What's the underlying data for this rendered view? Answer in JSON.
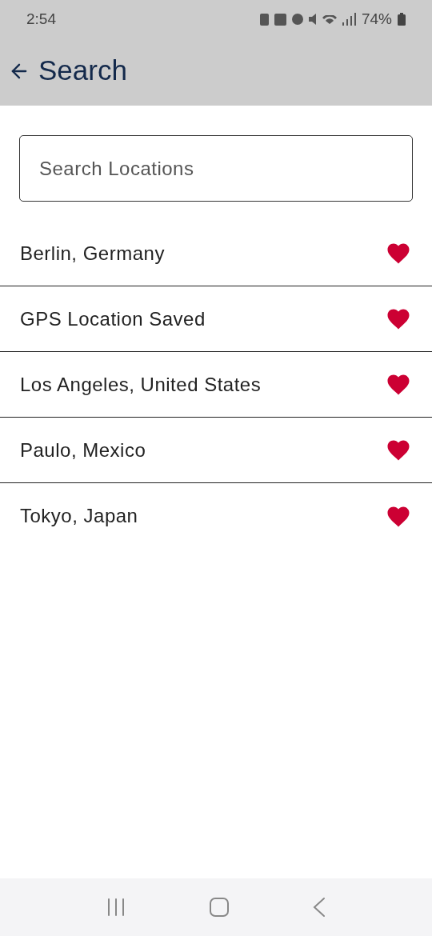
{
  "status_bar": {
    "time": "2:54",
    "battery": "74%"
  },
  "header": {
    "title": "Search"
  },
  "search": {
    "placeholder": "Search Locations"
  },
  "locations": [
    {
      "name": "Berlin, Germany",
      "favorite": true
    },
    {
      "name": "GPS Location Saved",
      "favorite": true
    },
    {
      "name": "Los Angeles, United States",
      "favorite": true
    },
    {
      "name": "Paulo, Mexico",
      "favorite": true
    },
    {
      "name": "Tokyo, Japan",
      "favorite": true
    }
  ]
}
